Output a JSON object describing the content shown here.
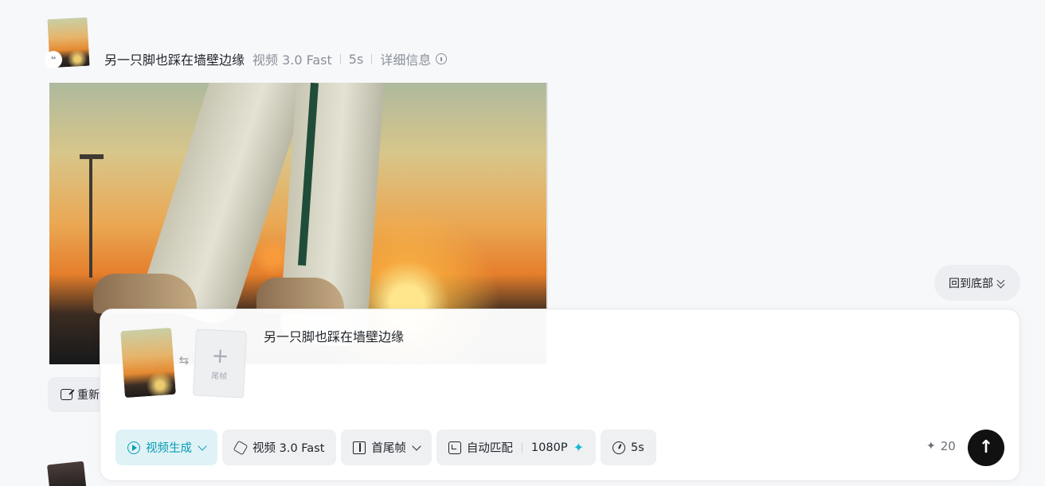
{
  "history_item": {
    "prompt": "另一只脚也踩在墙壁边缘",
    "model": "视频 3.0 Fast",
    "duration": "5s",
    "details_label": "详细信息",
    "quote_glyph": "❝",
    "regenerate_label": "重新"
  },
  "scroll_to_bottom_label": "回到底部",
  "composer": {
    "prompt": "另一只脚也踩在墙壁边缘",
    "last_frame_label": "尾帧",
    "add_glyph": "+",
    "swap_glyph": "⇆",
    "toolbar": {
      "mode": "视频生成",
      "model": "视频 3.0 Fast",
      "frame_mode": "首尾帧",
      "ratio": "自动匹配",
      "resolution": "1080P",
      "duration": "5s"
    },
    "credits": "20",
    "credits_icon": "sparkle-icon",
    "send_icon": "arrow-up-icon"
  },
  "colors": {
    "accent": "#0a9bb5",
    "accent_bg": "#dff3f7",
    "send": "#111111"
  }
}
